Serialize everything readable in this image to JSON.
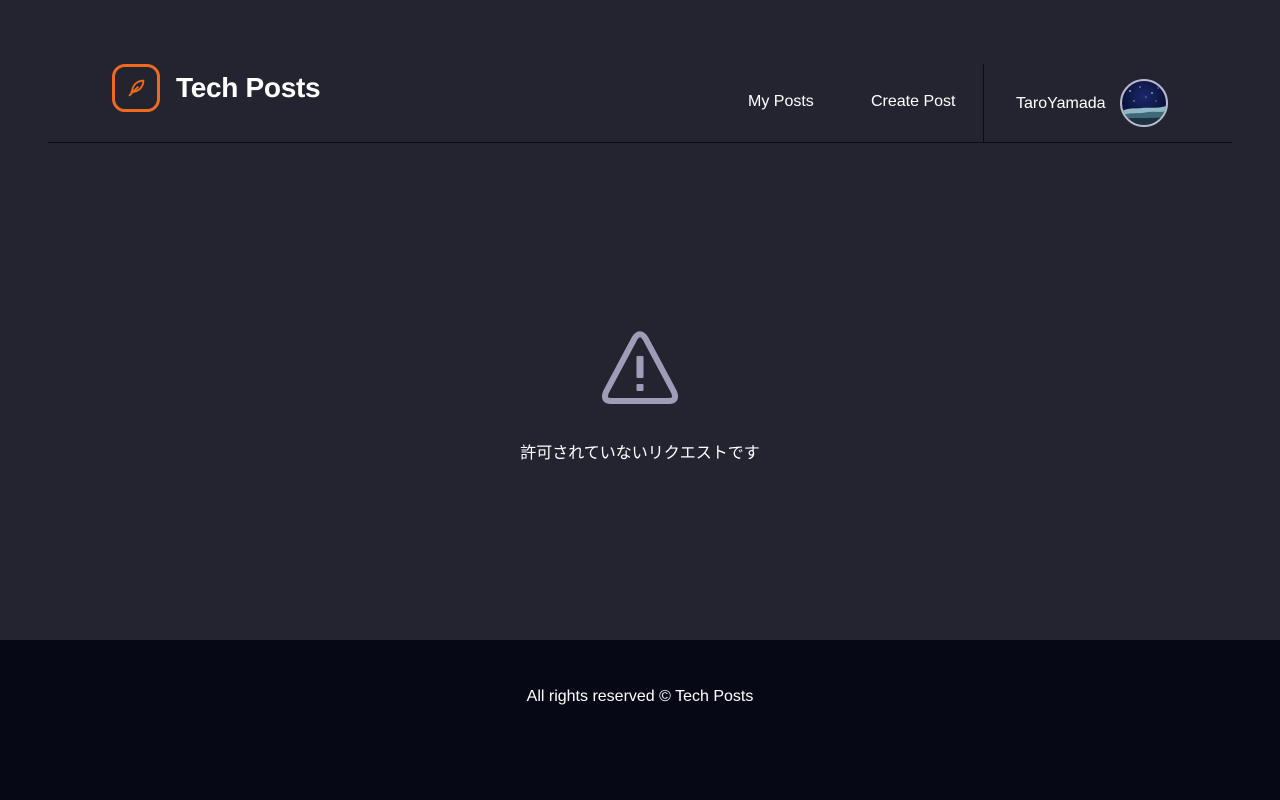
{
  "header": {
    "brand_name": "Tech Posts",
    "logo_icon": "feather-icon",
    "nav": {
      "my_posts": "My Posts",
      "create_post": "Create Post"
    },
    "user": {
      "name": "TaroYamada",
      "avatar": "night-sky-avatar"
    }
  },
  "main": {
    "icon": "warning-icon",
    "message": "許可されていないリクエストです"
  },
  "footer": {
    "text": "All rights reserved © Tech Posts"
  },
  "colors": {
    "background": "#242430",
    "footer_background": "#060816",
    "accent": "#f06a1d",
    "icon_muted": "#a09cb8",
    "text": "#ffffff"
  }
}
